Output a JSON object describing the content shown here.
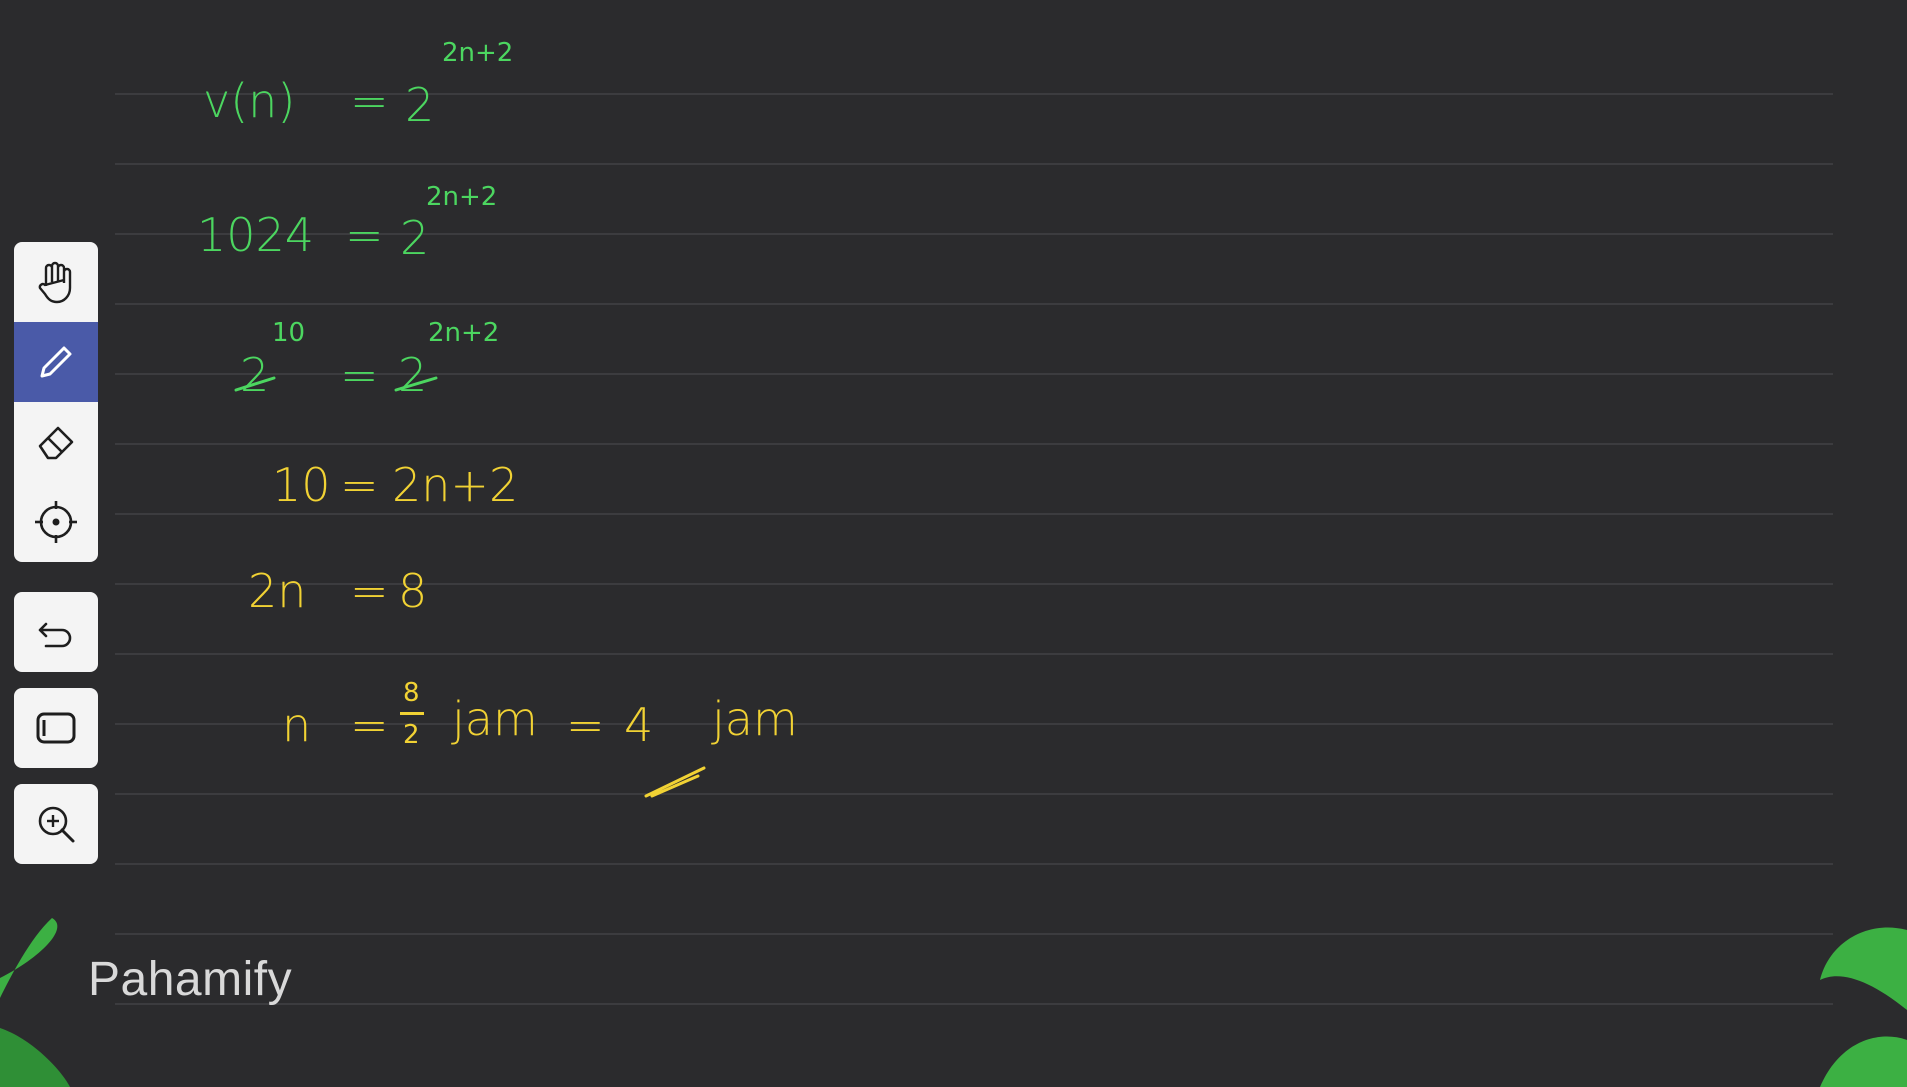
{
  "board": {
    "lines": [
      {
        "lhs": "v(n)",
        "eq": "=",
        "rhs": "2",
        "exp": "2n+2"
      },
      {
        "lhs": "1024",
        "eq": "=",
        "rhs": "2",
        "exp": "2n+2"
      },
      {
        "lhs": "2",
        "lhs_exp": "10",
        "eq": "=",
        "rhs": "2",
        "exp": "2n+2"
      },
      {
        "lhs": "10",
        "eq": "=",
        "rhs": "2n+2"
      },
      {
        "lhs": "2n",
        "eq": "=",
        "rhs": "8"
      },
      {
        "lhs": "n",
        "eq": "=",
        "frac_num": "8",
        "frac_den": "2",
        "unit1": "jam",
        "eq2": "=",
        "result": "4",
        "unit2": "jam"
      }
    ]
  },
  "toolbar": {
    "tools": [
      "hand-icon",
      "pen-icon",
      "eraser-icon",
      "laser-pointer-icon"
    ],
    "active_tool": "pen-icon",
    "actions": [
      "undo-icon",
      "clear-icon",
      "zoom-in-icon"
    ],
    "active_color": "#4a5aa8"
  },
  "brand": {
    "logo_text": "Pahamify",
    "leaf_color": "#3cb043"
  },
  "colors": {
    "background": "#2b2b2d",
    "green_ink": "#4cd660",
    "yellow_ink": "#f1d234"
  }
}
